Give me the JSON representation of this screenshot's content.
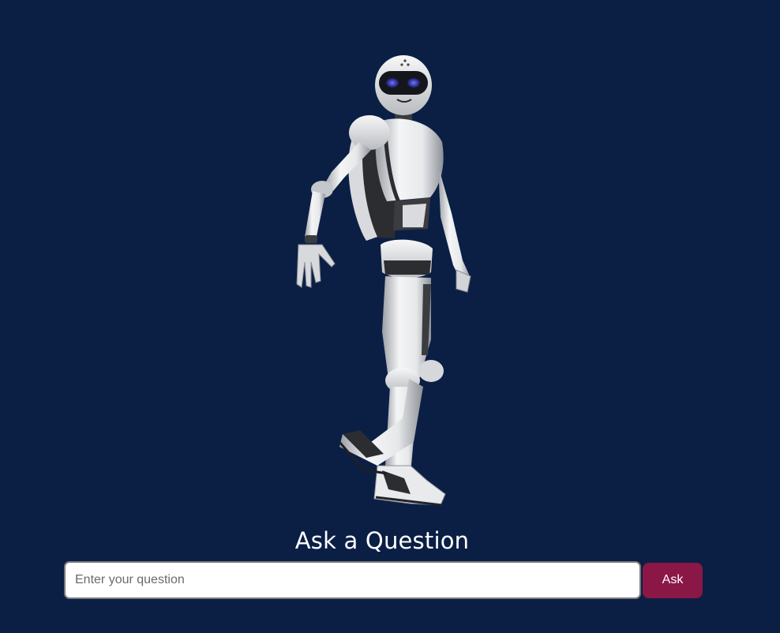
{
  "robot": {
    "image_name": "robot-3d-figure"
  },
  "ask": {
    "heading": "Ask a Question",
    "input_placeholder": "Enter your question",
    "input_value": "",
    "button_label": "Ask"
  },
  "colors": {
    "background": "#0b1f45",
    "button": "#8b1747",
    "heading_text": "#ffffff"
  }
}
